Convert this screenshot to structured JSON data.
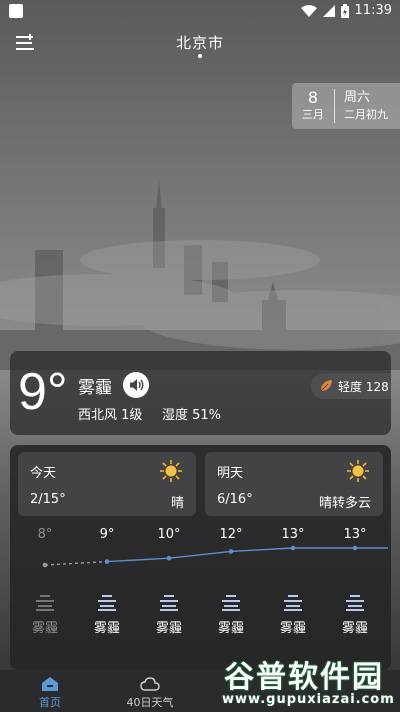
{
  "status": {
    "time": "11:39"
  },
  "header": {
    "city": "北京市"
  },
  "date_card": {
    "day": "8",
    "month": "三月",
    "weekday": "周六",
    "lunar": "二月初九"
  },
  "current": {
    "temperature": "9°",
    "condition": "雾霾",
    "wind": "西北风 1级",
    "humidity_label": "湿度 51%",
    "aqi_text": "轻度 128"
  },
  "days": [
    {
      "label": "今天",
      "range": "2/15°",
      "condition": "晴",
      "icon": "sun-icon"
    },
    {
      "label": "明天",
      "range": "6/16°",
      "condition": "晴转多云",
      "icon": "sun-icon"
    }
  ],
  "chart_data": {
    "type": "line",
    "values": [
      8,
      9,
      10,
      12,
      13,
      13
    ],
    "labels": [
      "8°",
      "9°",
      "10°",
      "12°",
      "13°",
      "13°"
    ],
    "conditions": [
      "雾霾",
      "雾霾",
      "雾霾",
      "雾霾",
      "雾霾",
      "雾霾"
    ],
    "past_count": 1,
    "ylim": [
      8,
      13
    ]
  },
  "nav": [
    {
      "label": "首页",
      "icon": "home-icon",
      "active": true
    },
    {
      "label": "40日天气",
      "icon": "cloud-icon",
      "active": false
    }
  ],
  "watermark": {
    "title": "谷普软件园",
    "url": "www.gupuxiazai.com"
  },
  "colors": {
    "accent": "#5b9bd5",
    "line": "#5b8fcf",
    "past": "#9a9a9a"
  }
}
